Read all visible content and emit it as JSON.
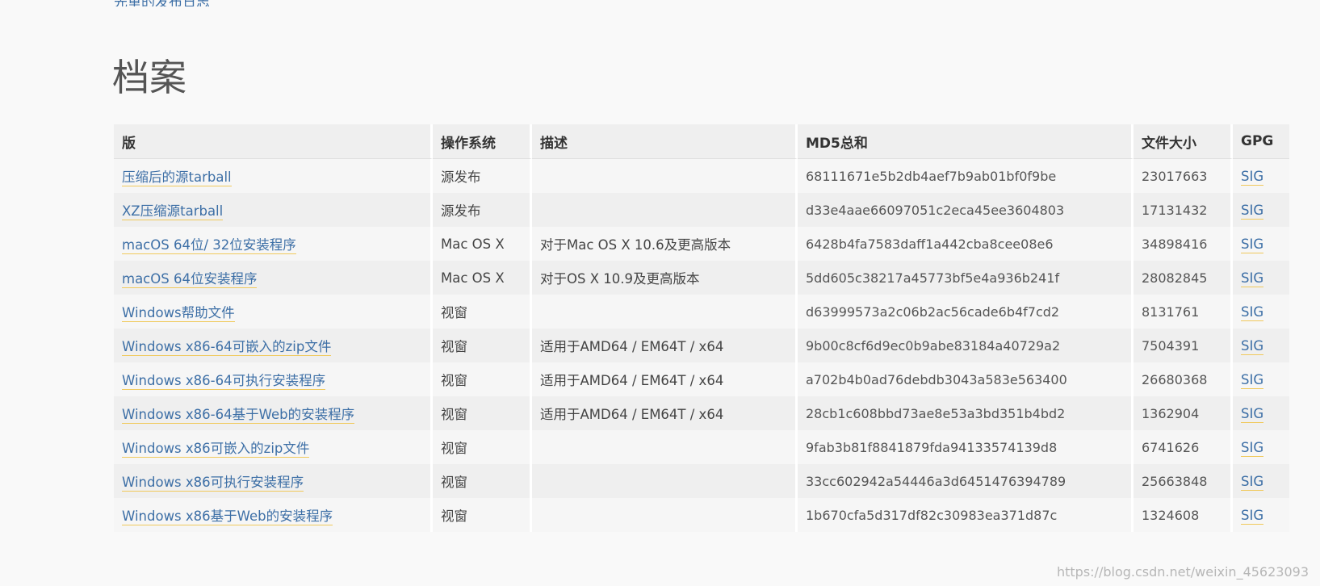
{
  "top_link": "先重的发布日志",
  "section_title": "档案",
  "table": {
    "headers": [
      "版",
      "操作系统",
      "描述",
      "MD5总和",
      "文件大小",
      "GPG"
    ],
    "rows": [
      {
        "version": "压缩后的源tarball",
        "os": "源发布",
        "description": "",
        "md5": "68111671e5b2db4aef7b9ab01bf0f9be",
        "size": "23017663",
        "gpg": "SIG"
      },
      {
        "version": "XZ压缩源tarball",
        "os": "源发布",
        "description": "",
        "md5": "d33e4aae66097051c2eca45ee3604803",
        "size": "17131432",
        "gpg": "SIG"
      },
      {
        "version": "macOS 64位/ 32位安装程序",
        "os": "Mac OS X",
        "description": "对于Mac OS X 10.6及更高版本",
        "md5": "6428b4fa7583daff1a442cba8cee08e6",
        "size": "34898416",
        "gpg": "SIG"
      },
      {
        "version": "macOS 64位安装程序",
        "os": "Mac OS X",
        "description": "对于OS X 10.9及更高版本",
        "md5": "5dd605c38217a45773bf5e4a936b241f",
        "size": "28082845",
        "gpg": "SIG"
      },
      {
        "version": "Windows帮助文件",
        "os": "视窗",
        "description": "",
        "md5": "d63999573a2c06b2ac56cade6b4f7cd2",
        "size": "8131761",
        "gpg": "SIG"
      },
      {
        "version": "Windows x86-64可嵌入的zip文件",
        "os": "视窗",
        "description": "适用于AMD64 / EM64T / x64",
        "md5": "9b00c8cf6d9ec0b9abe83184a40729a2",
        "size": "7504391",
        "gpg": "SIG"
      },
      {
        "version": "Windows x86-64可执行安装程序",
        "os": "视窗",
        "description": "适用于AMD64 / EM64T / x64",
        "md5": "a702b4b0ad76debdb3043a583e563400",
        "size": "26680368",
        "gpg": "SIG"
      },
      {
        "version": "Windows x86-64基于Web的安装程序",
        "os": "视窗",
        "description": "适用于AMD64 / EM64T / x64",
        "md5": "28cb1c608bbd73ae8e53a3bd351b4bd2",
        "size": "1362904",
        "gpg": "SIG"
      },
      {
        "version": "Windows x86可嵌入的zip文件",
        "os": "视窗",
        "description": "",
        "md5": "9fab3b81f8841879fda94133574139d8",
        "size": "6741626",
        "gpg": "SIG"
      },
      {
        "version": "Windows x86可执行安装程序",
        "os": "视窗",
        "description": "",
        "md5": "33cc602942a54446a3d6451476394789",
        "size": "25663848",
        "gpg": "SIG"
      },
      {
        "version": "Windows x86基于Web的安装程序",
        "os": "视窗",
        "description": "",
        "md5": "1b670cfa5d317df82c30983ea371d87c",
        "size": "1324608",
        "gpg": "SIG"
      }
    ]
  },
  "watermark": "https://blog.csdn.net/weixin_45623093"
}
